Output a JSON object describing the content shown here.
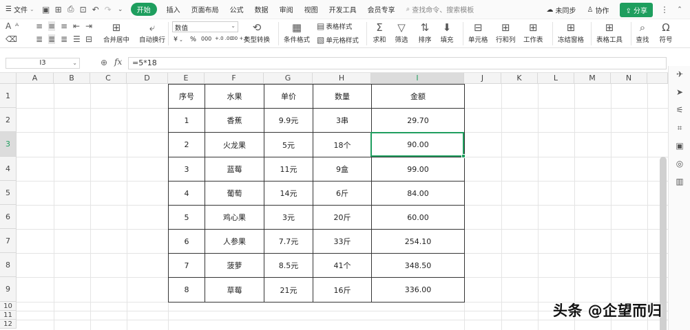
{
  "menubar": {
    "file": "文件",
    "tabs": [
      "开始",
      "插入",
      "页面布局",
      "公式",
      "数据",
      "审阅",
      "视图",
      "开发工具",
      "会员专享"
    ],
    "search_placeholder": "查找命令、搜索模板",
    "sync": "未同步",
    "collab": "协作",
    "share": "分享"
  },
  "ribbon": {
    "merge": "合并居中",
    "wrap": "自动换行",
    "number_format": "数值",
    "type_convert": "类型转换",
    "cond_format": "条件格式",
    "table_style": "表格样式",
    "cell_style": "单元格样式",
    "sum": "求和",
    "filter": "筛选",
    "sort": "排序",
    "fill": "填充",
    "cell": "单元格",
    "rowcol": "行和列",
    "worksheet": "工作表",
    "freeze": "冻结窗格",
    "table_tools": "表格工具",
    "find": "查找",
    "symbol": "符号",
    "currency": "¥",
    "percent": "%",
    "thousand": "000",
    "dec_add": "+.0 .00",
    "dec_sub": ".00 +.0"
  },
  "formula_bar": {
    "name_box": "I3",
    "fx": "fx",
    "formula": "=5*18"
  },
  "columns": [
    "A",
    "B",
    "C",
    "D",
    "E",
    "F",
    "G",
    "H",
    "I",
    "J",
    "K",
    "L",
    "M",
    "N"
  ],
  "rows": [
    "1",
    "2",
    "3",
    "4",
    "5",
    "6",
    "7",
    "8",
    "9",
    "10",
    "11",
    "12"
  ],
  "table": {
    "headers": [
      "序号",
      "水果",
      "单价",
      "数量",
      "金额"
    ],
    "rows": [
      [
        "1",
        "香蕉",
        "9.9元",
        "3串",
        "29.70"
      ],
      [
        "2",
        "火龙果",
        "5元",
        "18个",
        "90.00"
      ],
      [
        "3",
        "蓝莓",
        "11元",
        "9盒",
        "99.00"
      ],
      [
        "4",
        "葡萄",
        "14元",
        "6斤",
        "84.00"
      ],
      [
        "5",
        "鸡心果",
        "3元",
        "20斤",
        "60.00"
      ],
      [
        "6",
        "人参果",
        "7.7元",
        "33斤",
        "254.10"
      ],
      [
        "7",
        "菠萝",
        "8.5元",
        "41个",
        "348.50"
      ],
      [
        "8",
        "草莓",
        "21元",
        "16斤",
        "336.00"
      ]
    ]
  },
  "watermark": "头条 @企望而归",
  "colors": {
    "accent": "#1e9e5e"
  }
}
